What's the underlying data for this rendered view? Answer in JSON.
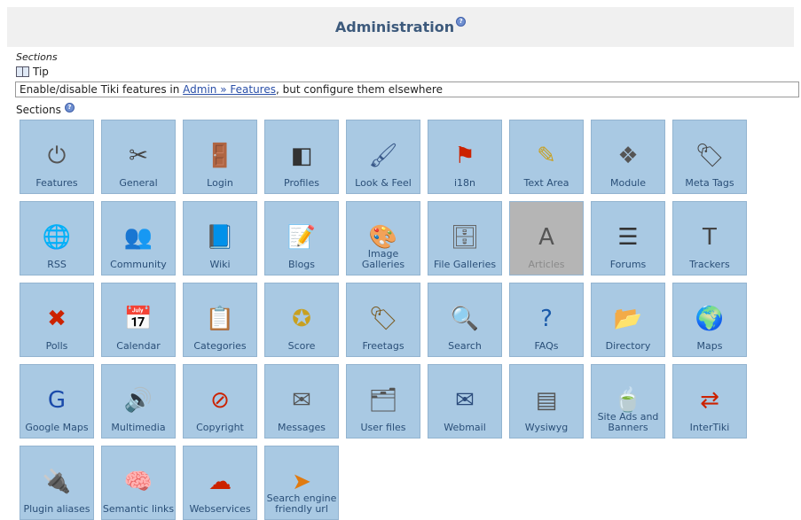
{
  "header": {
    "title": "Administration"
  },
  "sections_caption": "Sections",
  "tip": {
    "title": "Tip",
    "text_before": "Enable/disable Tiki features in ",
    "link_text": "Admin » Features",
    "text_after": ", but configure them elsewhere"
  },
  "sections_label": "Sections",
  "tiles": [
    {
      "label": "Features",
      "icon": "power-icon",
      "glyph": "⏻",
      "color": "#555555",
      "enabled": true
    },
    {
      "label": "General",
      "icon": "tools-icon",
      "glyph": "✂",
      "color": "#444444",
      "enabled": true
    },
    {
      "label": "Login",
      "icon": "door-login-icon",
      "glyph": "🚪",
      "color": "#7a5a20",
      "enabled": true
    },
    {
      "label": "Profiles",
      "icon": "profiles-icon",
      "glyph": "◧",
      "color": "#333333",
      "enabled": true
    },
    {
      "label": "Look & Feel",
      "icon": "look-feel-icon",
      "glyph": "🖌",
      "color": "#3a5a8a",
      "enabled": true
    },
    {
      "label": "i18n",
      "icon": "flag-icon",
      "glyph": "⚑",
      "color": "#cc2200",
      "enabled": true
    },
    {
      "label": "Text Area",
      "icon": "text-area-icon",
      "glyph": "✎",
      "color": "#c8a020",
      "enabled": true
    },
    {
      "label": "Module",
      "icon": "module-icon",
      "glyph": "❖",
      "color": "#555555",
      "enabled": true
    },
    {
      "label": "Meta Tags",
      "icon": "meta-tags-icon",
      "glyph": "🏷",
      "color": "#444444",
      "enabled": true
    },
    {
      "label": "RSS",
      "icon": "rss-globe-icon",
      "glyph": "🌐",
      "color": "#2a6a2a",
      "enabled": true
    },
    {
      "label": "Community",
      "icon": "community-icon",
      "glyph": "👥",
      "color": "#c85a20",
      "enabled": true
    },
    {
      "label": "Wiki",
      "icon": "wiki-icon",
      "glyph": "📘",
      "color": "#1a3a7a",
      "enabled": true
    },
    {
      "label": "Blogs",
      "icon": "blogs-icon",
      "glyph": "📝",
      "color": "#555555",
      "enabled": true
    },
    {
      "label": "Image Galleries",
      "icon": "palette-icon",
      "glyph": "🎨",
      "color": "#c85a20",
      "enabled": true
    },
    {
      "label": "File Galleries",
      "icon": "file-cabinet-icon",
      "glyph": "🗄",
      "color": "#666666",
      "enabled": true
    },
    {
      "label": "Articles",
      "icon": "articles-icon",
      "glyph": "A",
      "color": "#555555",
      "enabled": false
    },
    {
      "label": "Forums",
      "icon": "forums-icon",
      "glyph": "☰",
      "color": "#333333",
      "enabled": true
    },
    {
      "label": "Trackers",
      "icon": "trackers-icon",
      "glyph": "T",
      "color": "#444444",
      "enabled": true
    },
    {
      "label": "Polls",
      "icon": "polls-icon",
      "glyph": "✖",
      "color": "#cc2200",
      "enabled": true
    },
    {
      "label": "Calendar",
      "icon": "calendar-icon",
      "glyph": "📅",
      "color": "#c85a20",
      "enabled": true
    },
    {
      "label": "Categories",
      "icon": "categories-icon",
      "glyph": "📋",
      "color": "#7a5a20",
      "enabled": true
    },
    {
      "label": "Score",
      "icon": "score-stars-icon",
      "glyph": "✪",
      "color": "#c8a020",
      "enabled": true
    },
    {
      "label": "Freetags",
      "icon": "freetags-icon",
      "glyph": "🏷",
      "color": "#7a5a20",
      "enabled": true
    },
    {
      "label": "Search",
      "icon": "magnifier-icon",
      "glyph": "🔍",
      "color": "#2a4a7a",
      "enabled": true
    },
    {
      "label": "FAQs",
      "icon": "question-icon",
      "glyph": "?",
      "color": "#1a5aaa",
      "enabled": true
    },
    {
      "label": "Directory",
      "icon": "directory-icon",
      "glyph": "📂",
      "color": "#2a6a2a",
      "enabled": true
    },
    {
      "label": "Maps",
      "icon": "maps-globe-icon",
      "glyph": "🌍",
      "color": "#2a5aaa",
      "enabled": true
    },
    {
      "label": "Google Maps",
      "icon": "google-maps-icon",
      "glyph": "G",
      "color": "#1a4aaa",
      "enabled": true
    },
    {
      "label": "Multimedia",
      "icon": "multimedia-speaker-icon",
      "glyph": "🔊",
      "color": "#7a5a20",
      "enabled": true
    },
    {
      "label": "Copyright",
      "icon": "copyright-icon",
      "glyph": "⊘",
      "color": "#cc2200",
      "enabled": true
    },
    {
      "label": "Messages",
      "icon": "messages-icon",
      "glyph": "✉",
      "color": "#555555",
      "enabled": true
    },
    {
      "label": "User files",
      "icon": "user-files-icon",
      "glyph": "🗂",
      "color": "#555555",
      "enabled": true
    },
    {
      "label": "Webmail",
      "icon": "webmail-icon",
      "glyph": "✉",
      "color": "#2a4a7a",
      "enabled": true
    },
    {
      "label": "Wysiwyg",
      "icon": "wysiwyg-icon",
      "glyph": "▤",
      "color": "#555555",
      "enabled": true
    },
    {
      "label": "Site Ads and Banners",
      "icon": "site-ads-icon",
      "glyph": "🍵",
      "color": "#c85a20",
      "enabled": true
    },
    {
      "label": "InterTiki",
      "icon": "intertiki-arrows-icon",
      "glyph": "⇄",
      "color": "#cc2200",
      "enabled": true
    },
    {
      "label": "Plugin aliases",
      "icon": "plugin-aliases-icon",
      "glyph": "🔌",
      "color": "#444444",
      "enabled": true
    },
    {
      "label": "Semantic links",
      "icon": "semantic-brain-icon",
      "glyph": "🧠",
      "color": "#777777",
      "enabled": true
    },
    {
      "label": "Webservices",
      "icon": "webservices-icon",
      "glyph": "☁",
      "color": "#cc2200",
      "enabled": true
    },
    {
      "label": "Search engine friendly url",
      "icon": "sefurl-icon",
      "glyph": "➤",
      "color": "#e07a10",
      "enabled": true
    }
  ]
}
